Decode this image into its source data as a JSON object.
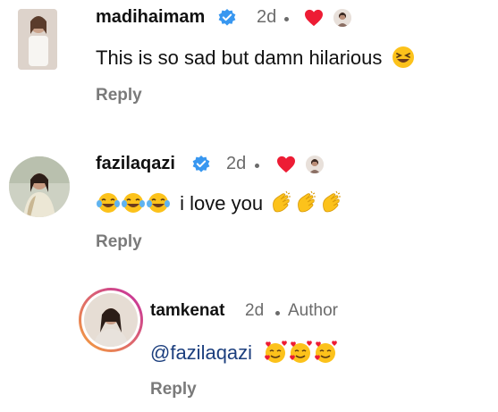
{
  "comments": [
    {
      "username": "madihaimam",
      "time": "2d",
      "text": "This is so sad but damn hilarious",
      "reply": "Reply"
    },
    {
      "username": "fazilaqazi",
      "time": "2d",
      "text": "i love you",
      "reply": "Reply"
    },
    {
      "username": "tamkenat",
      "time": "2d",
      "author_label": "Author",
      "mention": "@fazilaqazi",
      "reply": "Reply"
    }
  ],
  "colors": {
    "verified": "#3897f0",
    "heart": "#ed1c34",
    "reply": "#7a7a7a",
    "mention": "#1c3f7e",
    "story_ring_start": "#f6a33a",
    "story_ring_end": "#c32aa3"
  },
  "icons": [
    "verified-badge-icon",
    "liked-heart-icon",
    "laughing-emoji-icon",
    "clapping-hands-emoji-icon",
    "smiling-hearts-emoji-icon",
    "tears-of-joy-emoji-icon"
  ]
}
